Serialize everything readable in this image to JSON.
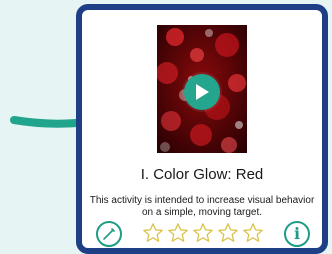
{
  "activity": {
    "title": "I. Color Glow: Red",
    "description": "This activity is intended to increase visual behavior on a simple, moving target.",
    "thumbnail_icon": "red-bokeh-image",
    "rating": {
      "value": 0,
      "max": 5
    }
  },
  "icons": {
    "play": "play-icon",
    "edit": "pencil-icon",
    "info": "info-icon",
    "star": "star-outline-icon",
    "pointer": "arrow-icon"
  },
  "info_glyph": "i",
  "colors": {
    "accent": "#24a58e",
    "card_border": "#1e3f86",
    "star_outline": "#d9c24a",
    "background": "#e6f4f3"
  }
}
